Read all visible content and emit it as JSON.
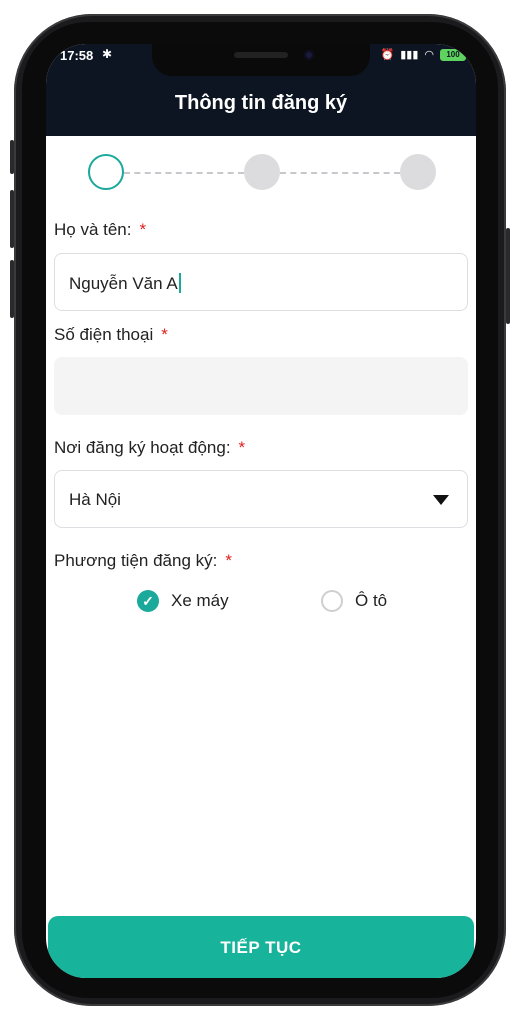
{
  "status_bar": {
    "time": "17:58",
    "battery": "100"
  },
  "header": {
    "title": "Thông tin đăng ký"
  },
  "steps": {
    "count": 3,
    "active_index": 0
  },
  "form": {
    "name": {
      "label": "Họ và tên:",
      "required_mark": "*",
      "value": "Nguyễn Văn A"
    },
    "phone": {
      "label": "Số điện thoại",
      "required_mark": "*",
      "value": ""
    },
    "region": {
      "label": "Nơi đăng ký hoạt động:",
      "required_mark": "*",
      "selected": "Hà Nội"
    },
    "vehicle": {
      "label": "Phương tiện đăng ký:",
      "required_mark": "*",
      "options": [
        {
          "label": "Xe máy",
          "checked": true
        },
        {
          "label": "Ô tô",
          "checked": false
        }
      ]
    }
  },
  "footer": {
    "next_label": "TIẾP TỤC"
  },
  "colors": {
    "accent": "#17b39a",
    "header_bg": "#0d1522",
    "required": "#e02020"
  }
}
